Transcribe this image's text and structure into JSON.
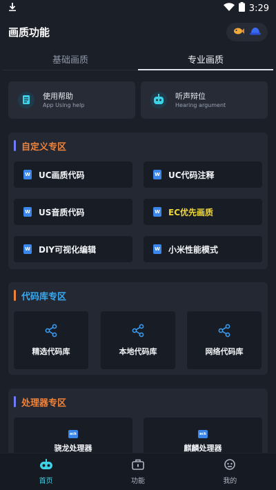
{
  "status_bar": {
    "time": "3:29",
    "download_icon": "download-icon",
    "wifi_icon": "wifi-icon",
    "battery_icon": "battery-icon"
  },
  "header": {
    "title": "画质功能",
    "actions": [
      "fish-icon",
      "hat-icon"
    ]
  },
  "tabs": [
    {
      "label": "基础画质",
      "active": false
    },
    {
      "label": "专业画质",
      "active": true
    }
  ],
  "help_cards": [
    {
      "title": "使用帮助",
      "subtitle": "App Using help",
      "icon": "help-doc-icon"
    },
    {
      "title": "听声辩位",
      "subtitle": "Hearing argument",
      "icon": "ear-robot-icon"
    }
  ],
  "sections": {
    "custom": {
      "title": "自定义专区",
      "bar_color": "#6f7cf5",
      "title_color": "#f0833a",
      "items": [
        {
          "label": "UC画质代码",
          "color": "#f2f4f8"
        },
        {
          "label": "UC代码注释",
          "color": "#f2f4f8"
        },
        {
          "label": "US音质代码",
          "color": "#f2f4f8"
        },
        {
          "label": "EC优先画质",
          "color": "#f0d83a"
        },
        {
          "label": "DIY可视化编辑",
          "color": "#f2f4f8"
        },
        {
          "label": "小米性能模式",
          "color": "#f2f4f8"
        }
      ]
    },
    "library": {
      "title": "代码库专区",
      "bar_color": "#f0833a",
      "title_color": "#3aa9f0",
      "items": [
        {
          "label": "精选代码库"
        },
        {
          "label": "本地代码库"
        },
        {
          "label": "网络代码库"
        }
      ]
    },
    "processor": {
      "title": "处理器专区",
      "bar_color": "#6f7cf5",
      "title_color": "#f0833a",
      "items": [
        {
          "label": "骁龙处理器",
          "icon_text": "ack"
        },
        {
          "label": "麒麟处理器",
          "icon_text": "ack"
        }
      ]
    }
  },
  "bottom_nav": [
    {
      "label": "首页",
      "icon": "gamepad-icon",
      "active": true
    },
    {
      "label": "功能",
      "icon": "toolbox-icon",
      "active": false
    },
    {
      "label": "我的",
      "icon": "robot-face-icon",
      "active": false
    }
  ],
  "colors": {
    "background": "#1b1f28",
    "card": "#262b36",
    "section": "#232833",
    "button": "#181c24",
    "accent": "#3fd2e6",
    "icon_blue": "#3a86ea"
  }
}
